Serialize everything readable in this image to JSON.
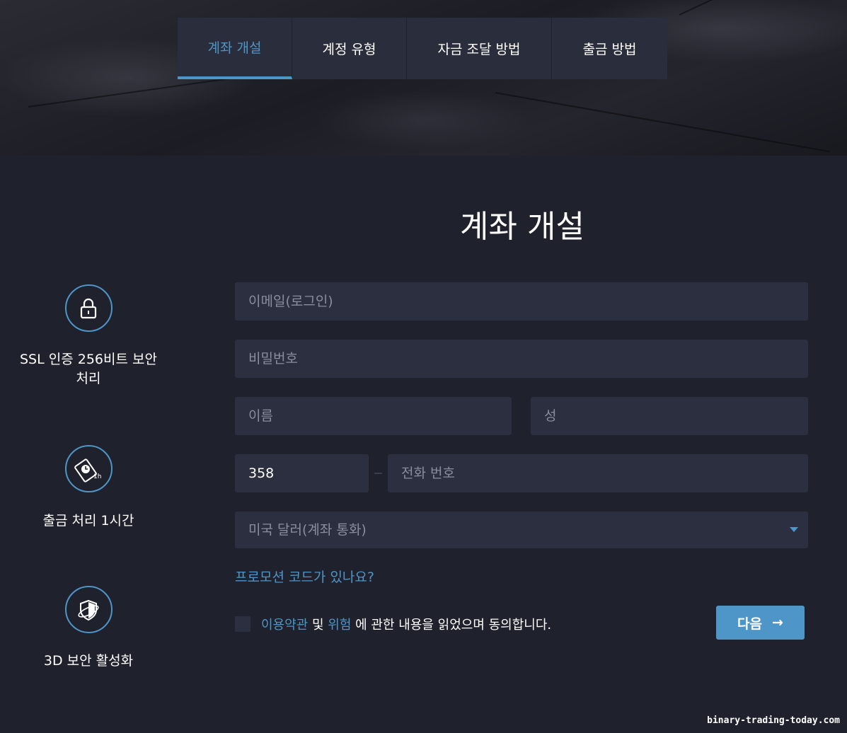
{
  "tabs": [
    {
      "label": "계좌 개설",
      "active": true
    },
    {
      "label": "계정 유형",
      "active": false
    },
    {
      "label": "자금 조달 방법",
      "active": false
    },
    {
      "label": "출금 방법",
      "active": false
    }
  ],
  "page_title": "계좌 개설",
  "features": [
    {
      "icon": "lock-icon",
      "label": "SSL 인증 256비트 보안 처리"
    },
    {
      "icon": "money-clock-icon",
      "label": "출금 처리 1시간"
    },
    {
      "icon": "shield-3d-icon",
      "label": "3D 보안 활성화"
    }
  ],
  "form": {
    "email_placeholder": "이메일(로그인)",
    "password_placeholder": "비밀번호",
    "first_name_placeholder": "이름",
    "last_name_placeholder": "성",
    "phone_code_value": "358",
    "phone_placeholder": "전화 번호",
    "currency_selected": "미국 달러(계좌 통화)",
    "promo_link": "프로모션 코드가 있나요?",
    "agree_terms_link": "이용약관",
    "agree_and": "및",
    "agree_risk_link": "위험",
    "agree_rest": "에 관한 내용을 읽었으며 동의합니다.",
    "next_label": "다음",
    "next_arrow": "→"
  },
  "watermark": "binary-trading-today.com",
  "colors": {
    "accent": "#4e95c8",
    "background": "#1f212d",
    "field": "#2c2f40",
    "tab": "#2a2d3c"
  }
}
